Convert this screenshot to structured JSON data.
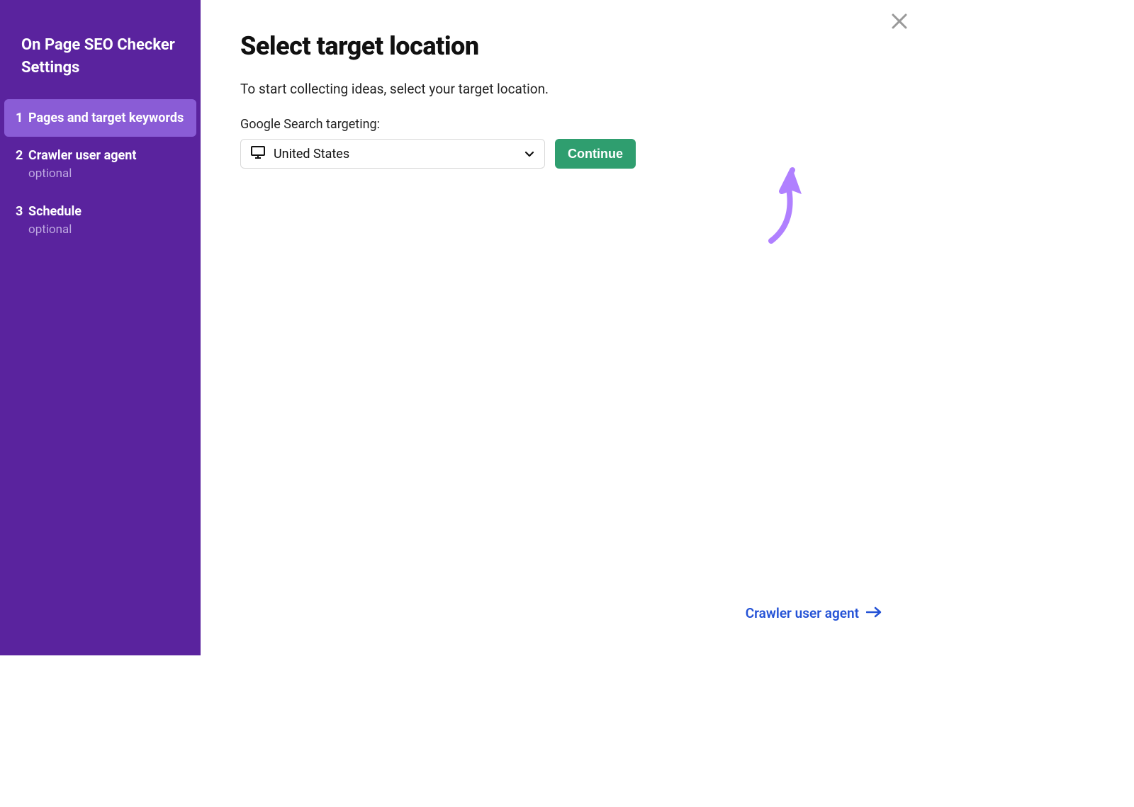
{
  "sidebar": {
    "title": "On Page SEO Checker Settings",
    "steps": [
      {
        "num": "1",
        "label": "Pages and target keywords",
        "optional": ""
      },
      {
        "num": "2",
        "label": "Crawler user agent",
        "optional": "optional"
      },
      {
        "num": "3",
        "label": "Schedule",
        "optional": "optional"
      }
    ]
  },
  "main": {
    "title": "Select target location",
    "description": "To start collecting ideas, select your target location.",
    "field_label": "Google Search targeting:",
    "dropdown_value": "United States",
    "continue_label": "Continue"
  },
  "footer": {
    "next_label": "Crawler user agent"
  }
}
